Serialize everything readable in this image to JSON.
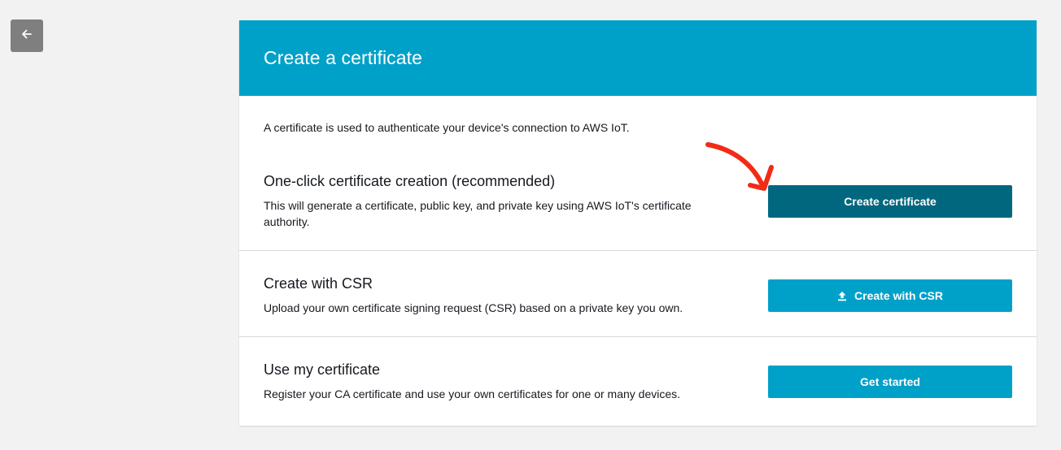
{
  "back": {
    "icon": "arrow-left-icon"
  },
  "header": {
    "title": "Create a certificate",
    "color": "#00a1c9"
  },
  "intro": "A certificate is used to authenticate your device's connection to AWS IoT.",
  "sections": [
    {
      "title": "One-click certificate creation (recommended)",
      "description": "This will generate a certificate, public key, and private key using AWS IoT's certificate authority.",
      "button_label": "Create certificate",
      "button_color": "#00677f"
    },
    {
      "title": "Create with CSR",
      "description": "Upload your own certificate signing request (CSR) based on a private key you own.",
      "button_label": "Create with CSR",
      "button_icon": "upload-icon",
      "button_color": "#00a1c9"
    },
    {
      "title": "Use my certificate",
      "description": "Register your CA certificate and use your own certificates for one or many devices.",
      "button_label": "Get started",
      "button_color": "#00a1c9"
    }
  ],
  "annotation": {
    "icon": "red-arrow-annotation-icon",
    "color": "#f22b16"
  }
}
